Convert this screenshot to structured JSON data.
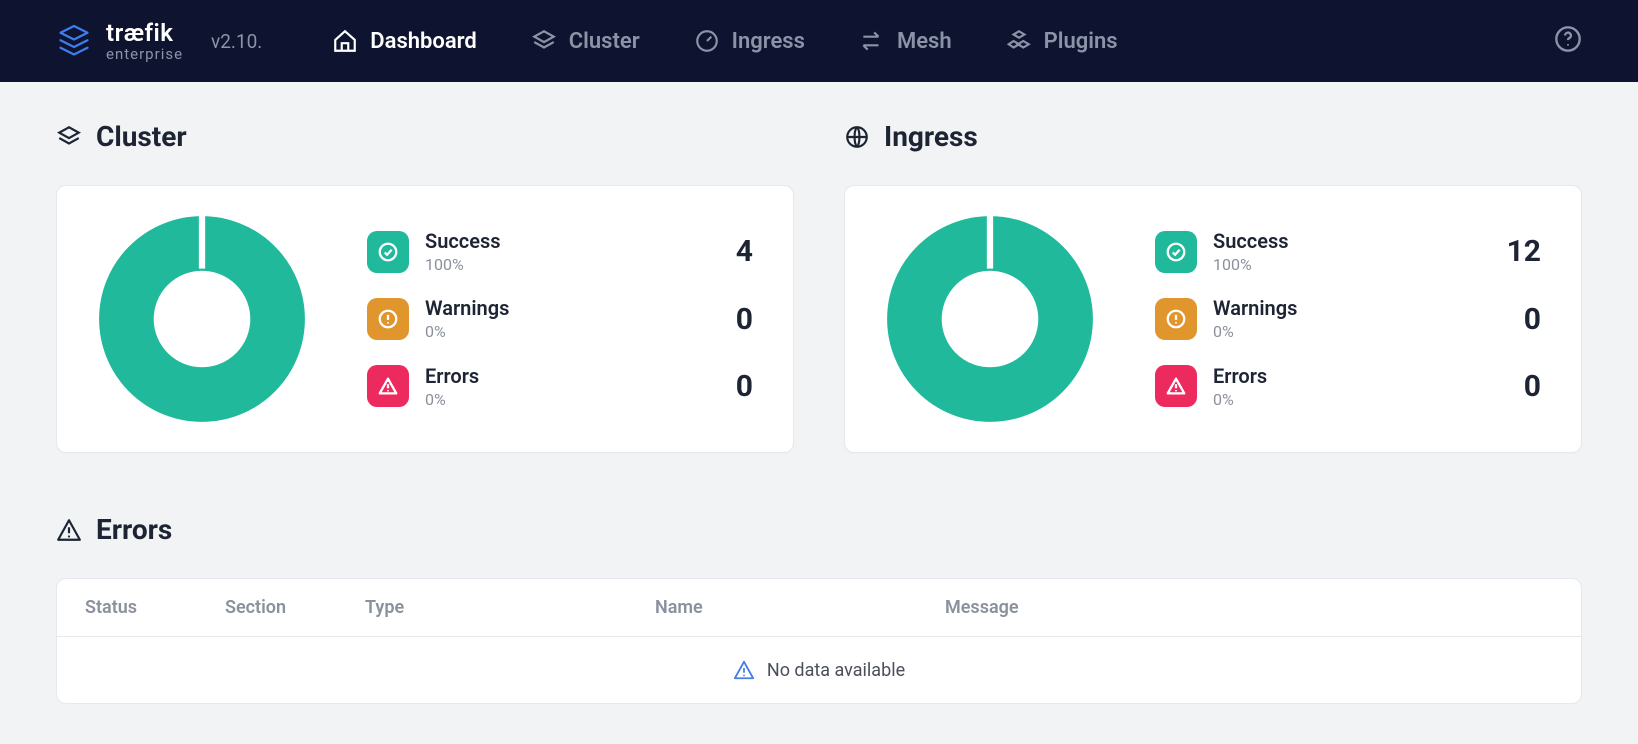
{
  "brand": {
    "line1": "træfik",
    "line2": "enterprise",
    "version": "v2.10."
  },
  "nav": {
    "dashboard": "Dashboard",
    "cluster": "Cluster",
    "ingress": "Ingress",
    "mesh": "Mesh",
    "plugins": "Plugins"
  },
  "colors": {
    "teal": "#20b99b",
    "amber": "#e0962c",
    "red": "#ec2a5e"
  },
  "sections": {
    "cluster": {
      "title": "Cluster",
      "stats": {
        "success": {
          "label": "Success",
          "pct": "100%",
          "value": "4"
        },
        "warnings": {
          "label": "Warnings",
          "pct": "0%",
          "value": "0"
        },
        "errors": {
          "label": "Errors",
          "pct": "0%",
          "value": "0"
        }
      }
    },
    "ingress": {
      "title": "Ingress",
      "stats": {
        "success": {
          "label": "Success",
          "pct": "100%",
          "value": "12"
        },
        "warnings": {
          "label": "Warnings",
          "pct": "0%",
          "value": "0"
        },
        "errors": {
          "label": "Errors",
          "pct": "0%",
          "value": "0"
        }
      }
    }
  },
  "errorsTable": {
    "title": "Errors",
    "columns": {
      "status": "Status",
      "section": "Section",
      "type": "Type",
      "name": "Name",
      "message": "Message"
    },
    "empty": "No data available"
  },
  "chart_data": [
    {
      "type": "pie",
      "title": "Cluster",
      "series": [
        {
          "name": "Success",
          "value": 4,
          "pct": 100,
          "color": "#20b99b"
        },
        {
          "name": "Warnings",
          "value": 0,
          "pct": 0,
          "color": "#e0962c"
        },
        {
          "name": "Errors",
          "value": 0,
          "pct": 0,
          "color": "#ec2a5e"
        }
      ]
    },
    {
      "type": "pie",
      "title": "Ingress",
      "series": [
        {
          "name": "Success",
          "value": 12,
          "pct": 100,
          "color": "#20b99b"
        },
        {
          "name": "Warnings",
          "value": 0,
          "pct": 0,
          "color": "#e0962c"
        },
        {
          "name": "Errors",
          "value": 0,
          "pct": 0,
          "color": "#ec2a5e"
        }
      ]
    }
  ]
}
